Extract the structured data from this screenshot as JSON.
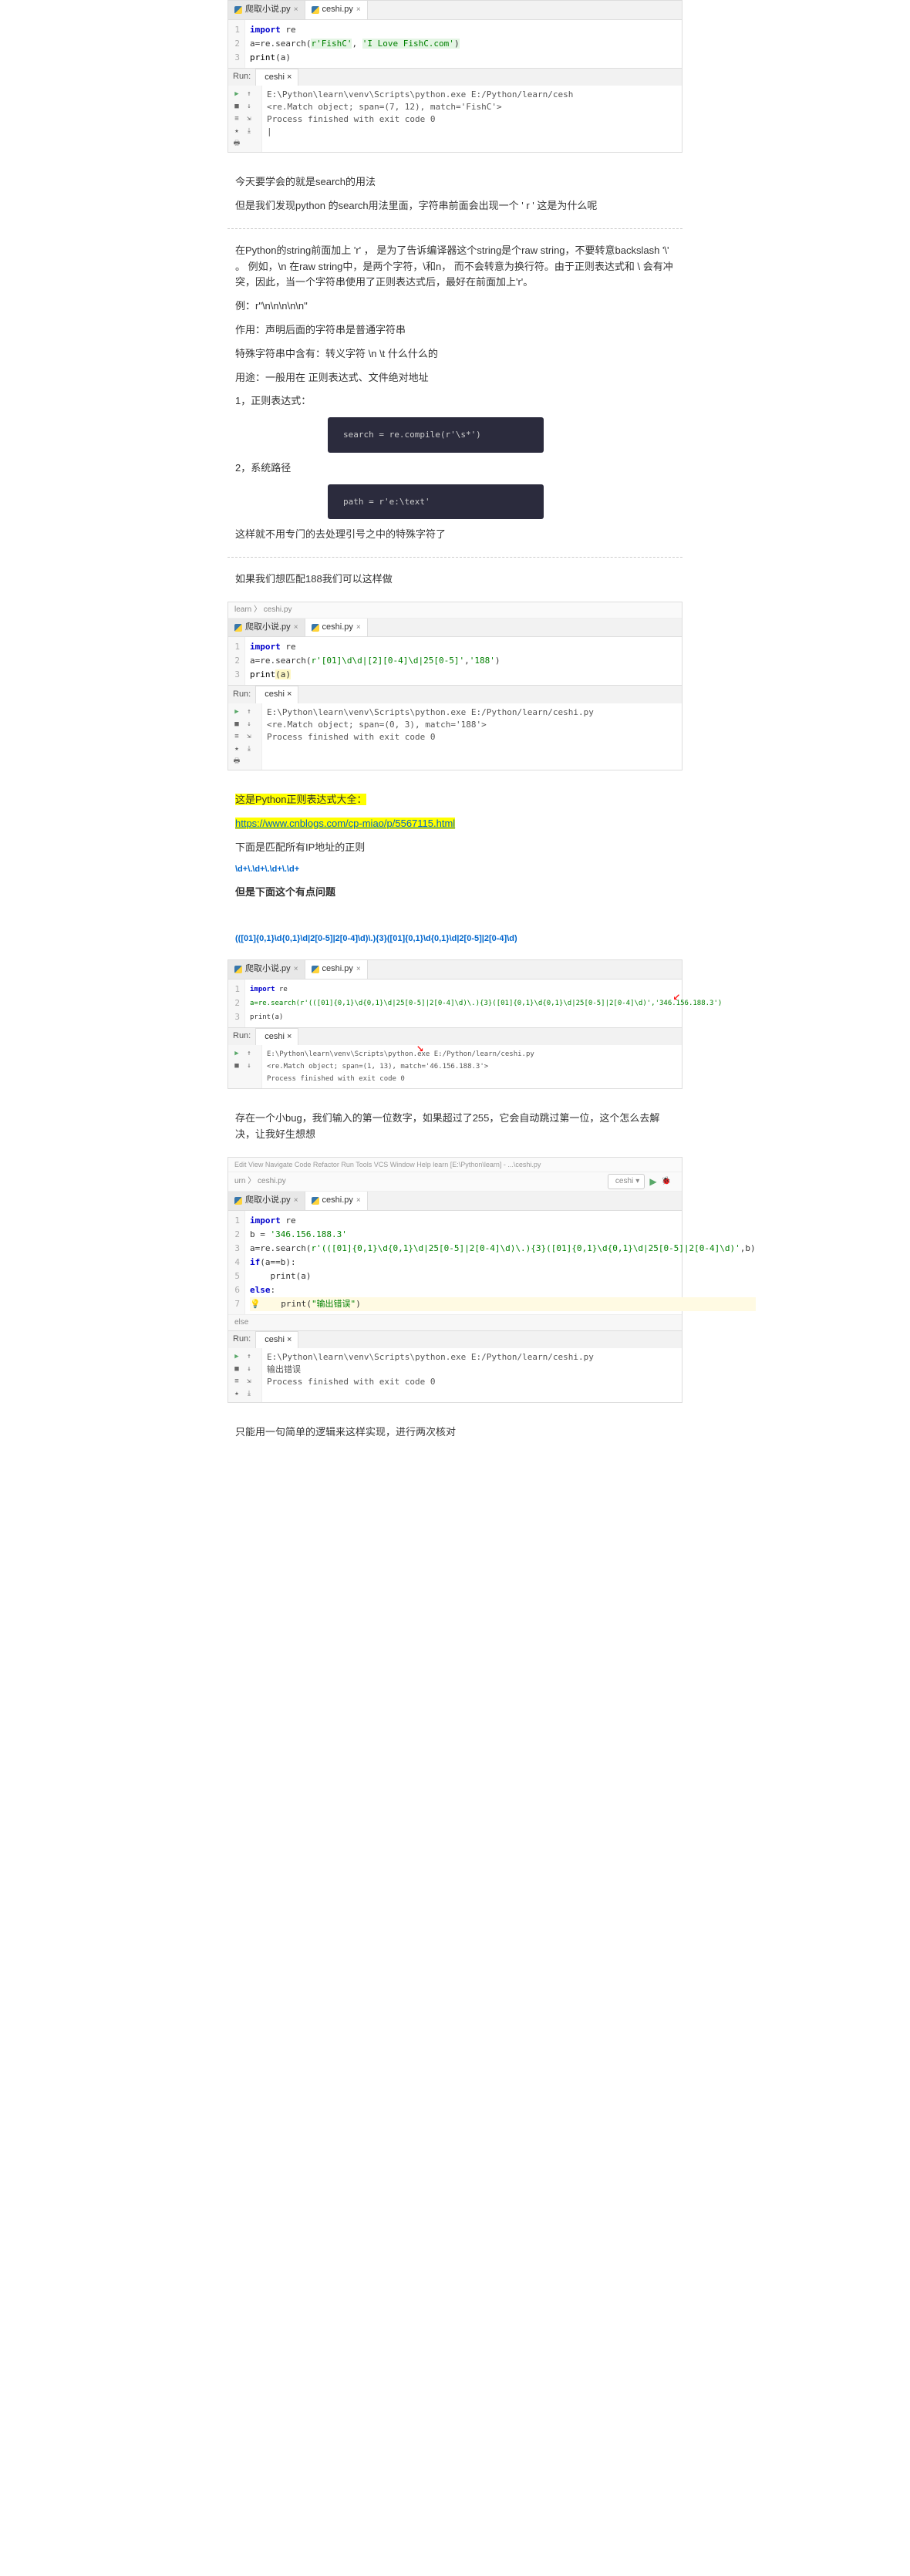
{
  "ide1": {
    "tabs": [
      {
        "name": "爬取小说.py",
        "active": false
      },
      {
        "name": "ceshi.py",
        "active": true
      }
    ],
    "code": {
      "l1": {
        "kw": "import",
        "mod": " re"
      },
      "l2": {
        "var": "a",
        "eq": "=re.search(",
        "arg1": "r'FishC'",
        "comma": ", ",
        "arg2": "'I Love FishC.com'",
        "close": ")"
      },
      "l3": {
        "fn": "print",
        "open": "(",
        "arg": "a",
        "close": ")"
      }
    },
    "run_label": "Run:",
    "run_tab": "ceshi",
    "console": {
      "l1": "E:\\Python\\learn\\venv\\Scripts\\python.exe E:/Python/learn/cesh",
      "l2": "<re.Match object; span=(7, 12), match='FishC'>",
      "l3": "",
      "l4": "Process finished with exit code 0",
      "l5": "|"
    }
  },
  "text1": "今天要学会的就是search的用法",
  "text2": "但是我们发现python 的search用法里面，字符串前面会出现一个 ' r ' 这是为什么呢",
  "block1": {
    "p1": "在Python的string前面加上 'r' ， 是为了告诉编译器这个string是个raw string，不要转意backslash '\\' 。 例如，\\n 在raw string中，是两个字符，\\和n， 而不会转意为换行符。由于正则表达式和 \\ 会有冲突，因此，当一个字符串使用了正则表达式后，最好在前面加上'r'。",
    "p2": "例：r\"\\n\\n\\n\\n\\n\"",
    "p3": "作用：声明后面的字符串是普通字符串",
    "p4": "特殊字符串中含有：转义字符 \\n \\t 什么什么的",
    "p5": "用途：一般用在 正则表达式、文件绝对地址",
    "p6": "1，正则表达式：",
    "code1": "search = re.compile(r'\\s*')",
    "p7": "2，系统路径",
    "code2": "path = r'e:\\text'",
    "p8": "这样就不用专门的去处理引号之中的特殊字符了"
  },
  "text3": "如果我们想匹配188我们可以这样做",
  "ide2": {
    "breadcrumb": "learn 〉 ceshi.py",
    "tabs": [
      {
        "name": "爬取小说.py",
        "active": false
      },
      {
        "name": "ceshi.py",
        "active": true
      }
    ],
    "code": {
      "l1": {
        "kw": "import",
        "mod": " re"
      },
      "l2": {
        "var": "a",
        "eq": "=re.search(",
        "arg1": "r'[01]\\d\\d|[2][0-4]\\d|25[0-5]'",
        "comma": ",",
        "arg2": "'188'",
        "close": ")"
      },
      "l3": {
        "fn": "print",
        "open": "(",
        "arg": "a",
        "close": ")"
      }
    },
    "run_label": "Run:",
    "run_tab": "ceshi",
    "console": {
      "l1": "E:\\Python\\learn\\venv\\Scripts\\python.exe E:/Python/learn/ceshi.py",
      "l2": "<re.Match object; span=(0, 3), match='188'>",
      "l3": "",
      "l4": "Process finished with exit code 0"
    }
  },
  "highlight1": "这是Python正则表达式大全：",
  "link1": "https://www.cnblogs.com/cp-miao/p/5567115.html",
  "text4": "下面是匹配所有IP地址的正则",
  "regex_small": "\\d+\\.\\d+\\.\\d+\\.\\d+",
  "text5": "但是下面这个有点问题",
  "regex_long": "(([01]{0,1}\\d{0,1}\\d|2[0-5]|2[0-4]\\d)\\.){3}([01]{0,1}\\d{0,1}\\d|2[0-5]|2[0-4]\\d)",
  "ide3": {
    "tabs": [
      {
        "name": "爬取小说.py",
        "active": false
      },
      {
        "name": "ceshi.py",
        "active": true
      }
    ],
    "code": {
      "l1": "import re",
      "l2": "a=re.search(r'(([01]{0,1}\\d{0,1}\\d|25[0-5]|2[0-4]\\d)\\.){3}([01]{0,1}\\d{0,1}\\d|25[0-5]|2[0-4]\\d)','346.156.188.3')",
      "l3": "print(a)"
    },
    "run_label": "Run:",
    "run_tab": "ceshi",
    "console": {
      "l1": "E:\\Python\\learn\\venv\\Scripts\\python.exe E:/Python/learn/ceshi.py",
      "l2": "<re.Match object; span=(1, 13), match='46.156.188.3'>",
      "l3": "",
      "l4": "Process finished with exit code 0"
    }
  },
  "text6": "存在一个小bug，我们输入的第一位数字，如果超过了255，它会自动跳过第一位，这个怎么去解决，让我好生想想",
  "ide4": {
    "menubar": "Edit  View  Navigate  Code  Refactor  Run  Tools  VCS  Window  Help      learn [E:\\Python\\learn] - ...\\ceshi.py",
    "breadcrumb": "urn 〉 ceshi.py",
    "run_config": "ceshi",
    "tabs": [
      {
        "name": "爬取小说.py",
        "active": false
      },
      {
        "name": "ceshi.py",
        "active": true
      }
    ],
    "code": {
      "l1": {
        "kw": "import",
        "mod": " re"
      },
      "l2": {
        "var": "b = ",
        "str": "'346.156.188.3'"
      },
      "l3": {
        "var": "a=re.search(",
        "str": "r'(([01]{0,1}\\d{0,1}\\d|25[0-5]|2[0-4]\\d)\\.){3}([01]{0,1}\\d{0,1}\\d|25[0-5]|2[0-4]\\d)'",
        "comma": ",b)"
      },
      "l4": {
        "kw": "if",
        "cond": "(a==b):"
      },
      "l5": {
        "fn": "    print",
        "arg": "(a)"
      },
      "l6": {
        "kw": "else",
        "colon": ":"
      },
      "l7": {
        "fn": "    print",
        "open": "(",
        "str": "\"输出错误\"",
        "close": ")"
      }
    },
    "status": "else",
    "run_label": "Run:",
    "run_tab": "ceshi",
    "console": {
      "l1": "E:\\Python\\learn\\venv\\Scripts\\python.exe E:/Python/learn/ceshi.py",
      "l2": "输出错误",
      "l3": "",
      "l4": "Process finished with exit code 0"
    }
  },
  "text7": "只能用一句简单的逻辑来这样实现，进行两次核对"
}
